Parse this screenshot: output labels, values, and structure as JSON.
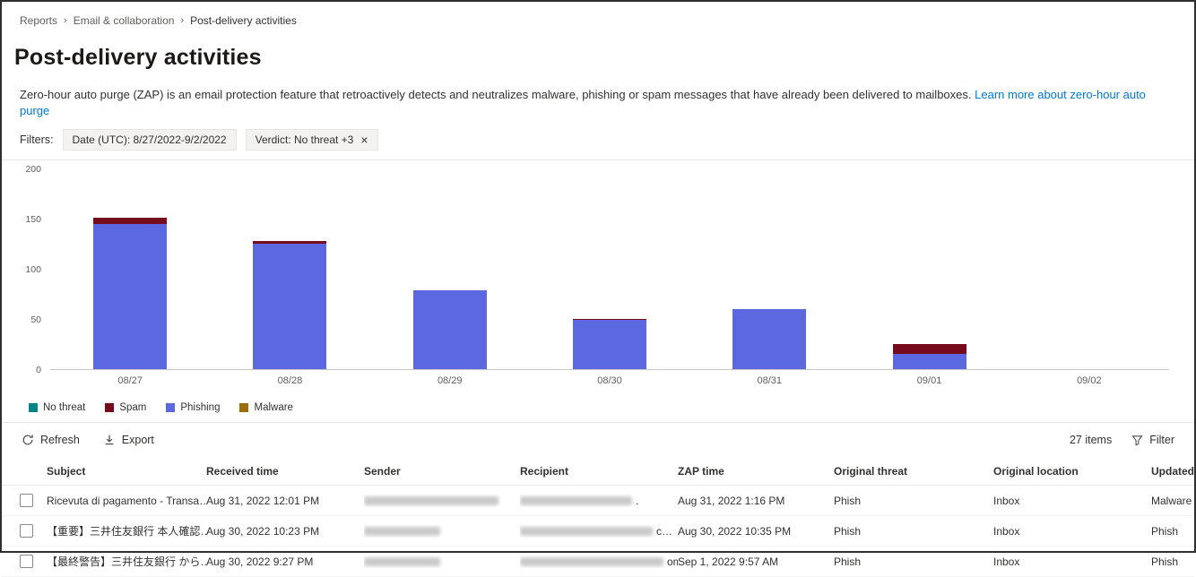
{
  "breadcrumb": {
    "items": [
      "Reports",
      "Email & collaboration",
      "Post-delivery activities"
    ]
  },
  "page": {
    "title": "Post-delivery activities",
    "description": "Zero-hour auto purge (ZAP) is an email protection feature that retroactively detects and neutralizes malware, phishing or spam messages that have already been delivered to mailboxes.",
    "learn_more": "Learn more about zero-hour auto purge"
  },
  "filters": {
    "label": "Filters:",
    "chips": [
      {
        "text": "Date (UTC): 8/27/2022-9/2/2022",
        "closable": false
      },
      {
        "text": "Verdict: No threat +3",
        "closable": true
      }
    ]
  },
  "chart_data": {
    "type": "bar",
    "stacked": true,
    "title": "",
    "xlabel": "",
    "ylabel": "",
    "categories": [
      "08/27",
      "08/28",
      "08/29",
      "08/30",
      "08/31",
      "09/01",
      "09/02"
    ],
    "series": [
      {
        "name": "No threat",
        "color": "#038387",
        "values": [
          0,
          0,
          0,
          0,
          0,
          0,
          0
        ]
      },
      {
        "name": "Phishing",
        "color": "#5b68e0",
        "values": [
          145,
          126,
          79,
          49,
          60,
          15,
          0
        ]
      },
      {
        "name": "Spam",
        "color": "#750b1c",
        "values": [
          7,
          2,
          0,
          1,
          0,
          10,
          0
        ]
      },
      {
        "name": "Malware",
        "color": "#986f0b",
        "values": [
          0,
          0,
          0,
          0,
          0,
          0,
          0
        ]
      }
    ],
    "legend": [
      {
        "label": "No threat",
        "color": "#038387"
      },
      {
        "label": "Spam",
        "color": "#750b1c"
      },
      {
        "label": "Phishing",
        "color": "#5b68e0"
      },
      {
        "label": "Malware",
        "color": "#986f0b"
      }
    ],
    "ylim": [
      0,
      200
    ],
    "yticks": [
      0,
      50,
      100,
      150,
      200
    ],
    "grid": false,
    "legend_position": "bottom"
  },
  "toolbar": {
    "refresh_label": "Refresh",
    "export_label": "Export",
    "items_count": "27 items",
    "filter_label": "Filter"
  },
  "table": {
    "columns": [
      "Subject",
      "Received time",
      "Sender",
      "Recipient",
      "ZAP time",
      "Original threat",
      "Original location",
      "Updated threat"
    ],
    "rows": [
      [
        "Ricevuta di pagamento - Transa…",
        "Aug 31, 2022 12:01 PM",
        {
          "redacted": 150
        },
        {
          "redacted": 125,
          "suffix": "."
        },
        "Aug 31, 2022 1:16 PM",
        "Phish",
        "Inbox",
        "Malware"
      ],
      [
        "【重要】三井住友銀行 本人確認…",
        "Aug 30, 2022 10:23 PM",
        {
          "redacted": 85
        },
        {
          "redacted": 148,
          "suffix": "c…"
        },
        "Aug 30, 2022 10:35 PM",
        "Phish",
        "Inbox",
        "Phish"
      ],
      [
        "【最終警告】三井住友銀行 から…",
        "Aug 30, 2022 9:27 PM",
        {
          "redacted": 85
        },
        {
          "redacted": 160,
          "suffix": "om"
        },
        "Sep 1, 2022 9:57 AM",
        "Phish",
        "Inbox",
        "Phish"
      ]
    ]
  }
}
